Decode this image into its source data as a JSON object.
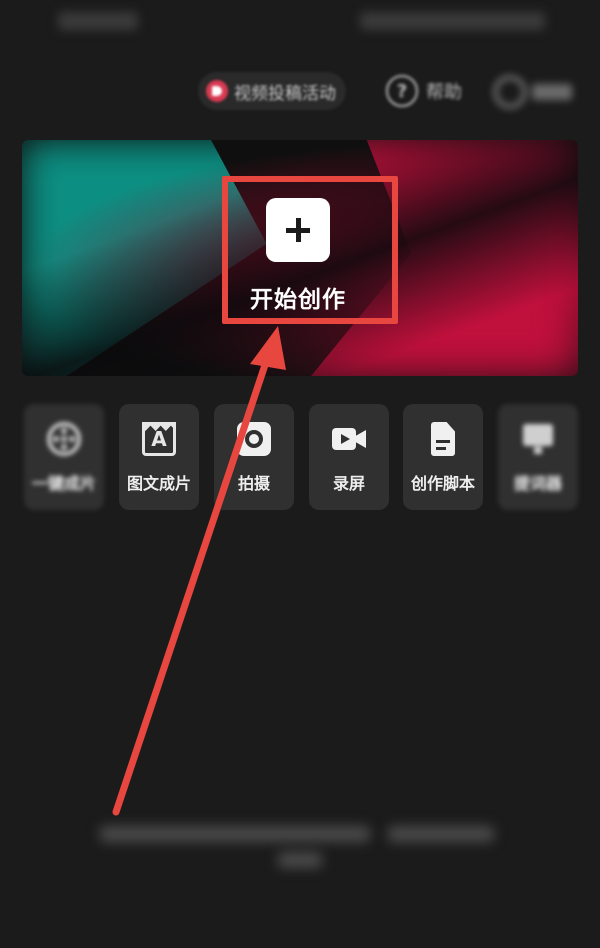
{
  "topbar": {
    "activity_label": "视频投稿活动",
    "help_label": "帮助"
  },
  "hero": {
    "start_label": "开始创作"
  },
  "tools": [
    {
      "label": "一键成片",
      "icon": "film-reel-icon"
    },
    {
      "label": "图文成片",
      "icon": "text-to-video-icon"
    },
    {
      "label": "拍摄",
      "icon": "camera-icon"
    },
    {
      "label": "录屏",
      "icon": "screen-record-icon"
    },
    {
      "label": "创作脚本",
      "icon": "script-doc-icon"
    },
    {
      "label": "提词器",
      "icon": "teleprompter-icon"
    }
  ],
  "colors": {
    "background": "#1b1b1b",
    "highlight": "#e8473f",
    "teal": "#0c8f82",
    "crimson": "#c0103c",
    "tile": "#303030"
  }
}
